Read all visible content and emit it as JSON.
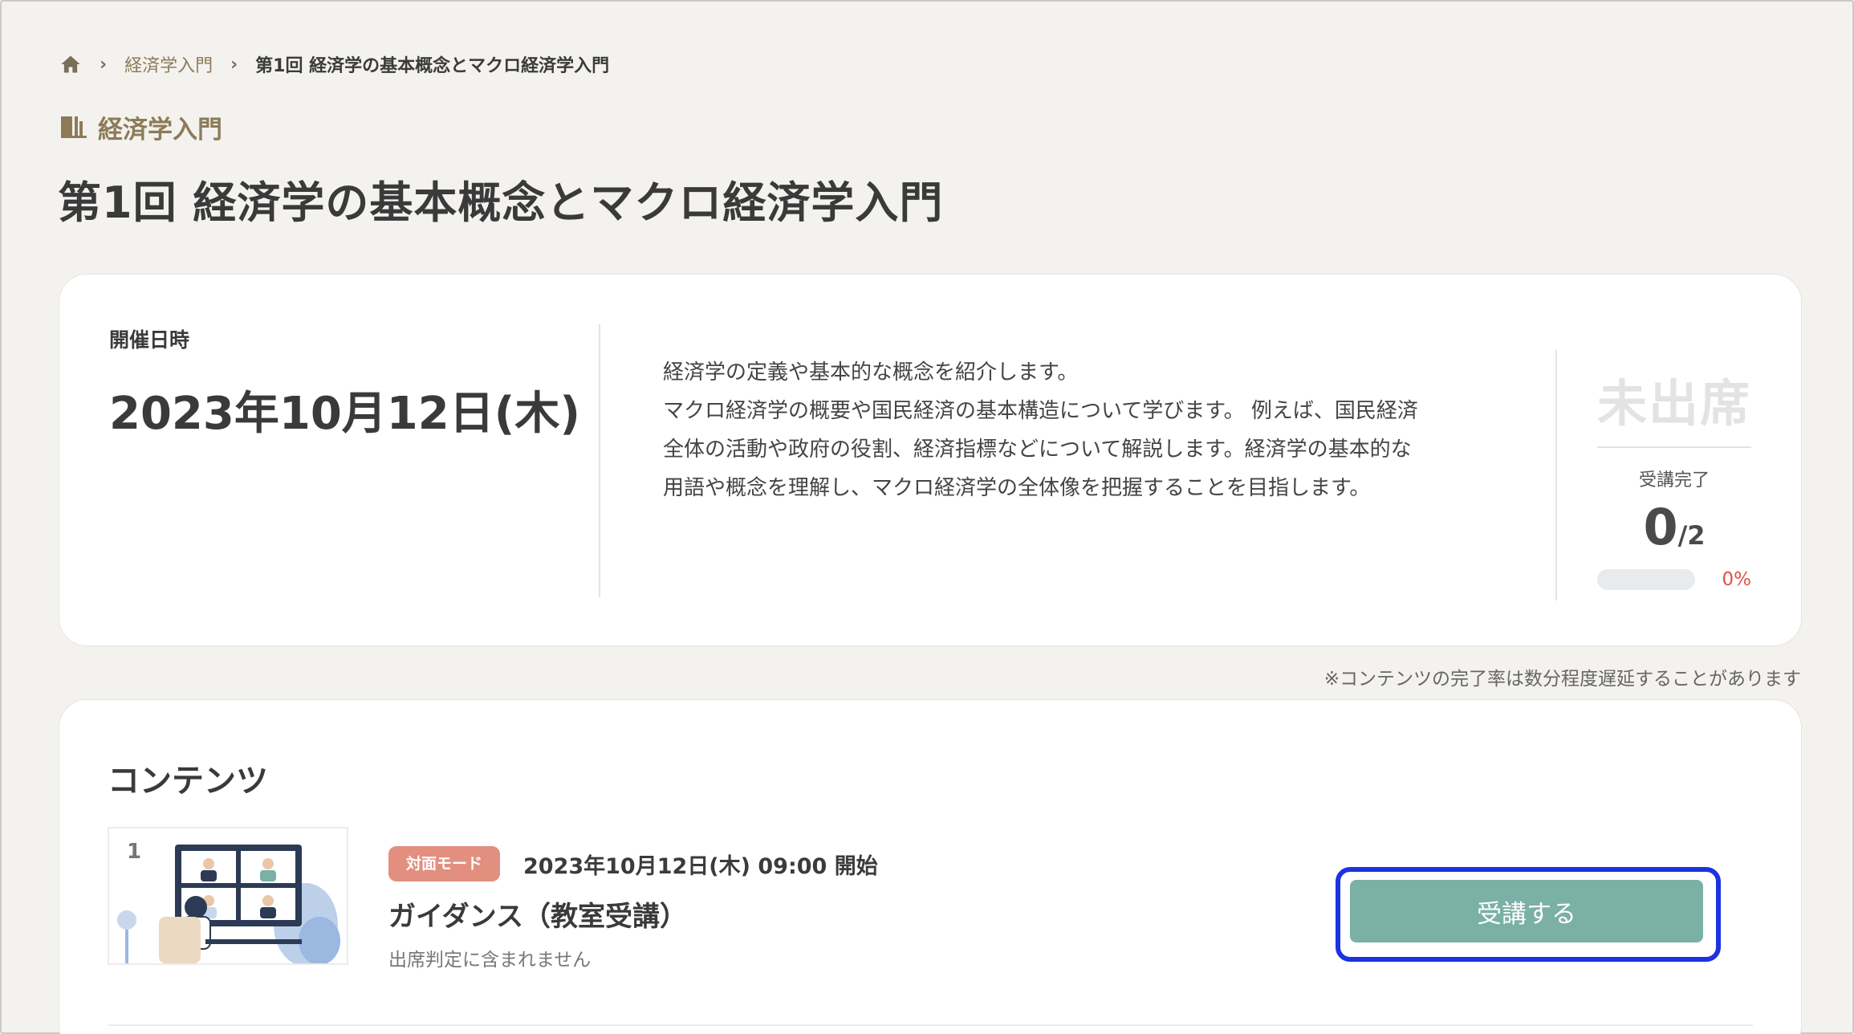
{
  "breadcrumb": {
    "home_icon": "home-icon",
    "items": [
      "経済学入門",
      "第1回 経済学の基本概念とマクロ経済学入門"
    ]
  },
  "course": {
    "icon": "book-icon",
    "name": "経済学入門"
  },
  "page_title": "第1回 経済学の基本概念とマクロ経済学入門",
  "session": {
    "date_label": "開催日時",
    "date_value": "2023年10月12日(木)",
    "description_lines": [
      "経済学の定義や基本的な概念を紹介します。",
      "マクロ経済学の概要や国民経済の基本構造について学びます。 例えば、国民経済",
      "全体の活動や政府の役割、経済指標などについて解説します。経済学の基本的な",
      "用語や概念を理解し、マクロ経済学の全体像を把握することを目指します。"
    ]
  },
  "attendance": {
    "status": "未出席",
    "completion_label": "受講完了",
    "completed": "0",
    "total": "/2",
    "progress_fraction": 0,
    "progress_text": "0%"
  },
  "note": "※コンテンツの完了率は数分程度遅延することがあります",
  "contents": {
    "title": "コンテンツ",
    "items": [
      {
        "index": "1",
        "mode": "対面モード",
        "start": "2023年10月12日(木) 09:00 開始",
        "title": "ガイダンス（教室受講）",
        "note": "出席判定に含まれません",
        "button_label": "受講する"
      }
    ]
  },
  "colors": {
    "background": "#f4f2ef",
    "accent_brown": "#8d7b58",
    "button_teal": "#7ab0a5",
    "badge_salmon": "#e28f80",
    "focus_blue": "#1b33e0",
    "percent_red": "#e0524d"
  }
}
